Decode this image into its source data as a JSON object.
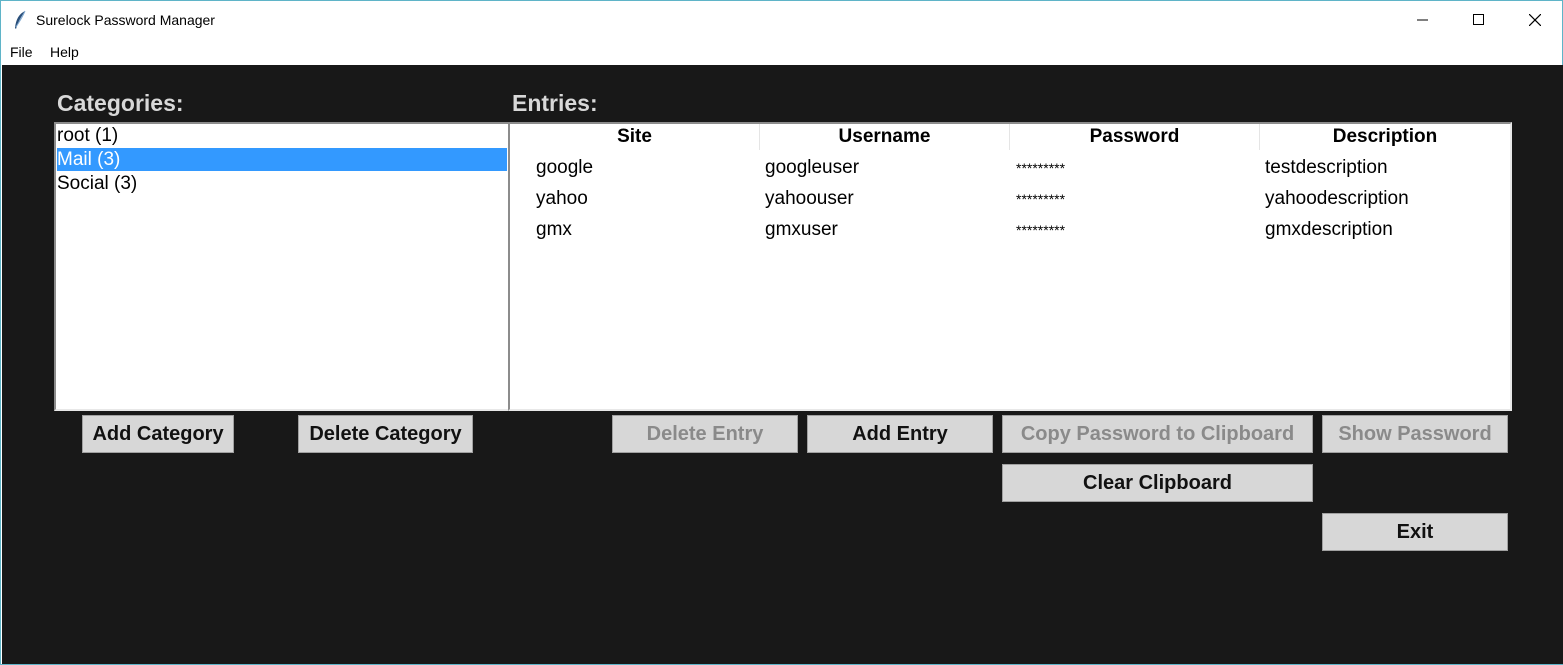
{
  "window": {
    "title": "Surelock Password Manager",
    "app_icon": "feather-icon",
    "controls": [
      "minimize-icon",
      "maximize-icon",
      "close-icon"
    ]
  },
  "menu": {
    "items": [
      {
        "label": "File"
      },
      {
        "label": "Help"
      }
    ]
  },
  "categories": {
    "label": "Categories:",
    "items": [
      {
        "label": "root (1)",
        "selected": false
      },
      {
        "label": "Mail (3)",
        "selected": true
      },
      {
        "label": "Social (3)",
        "selected": false
      }
    ],
    "buttons": {
      "add": "Add Category",
      "delete": "Delete Category"
    }
  },
  "entries": {
    "label": "Entries:",
    "columns": [
      "Site",
      "Username",
      "Password",
      "Description"
    ],
    "rows": [
      {
        "site": "google",
        "username": "googleuser",
        "password": "*********",
        "description": "testdescription"
      },
      {
        "site": "yahoo",
        "username": "yahoouser",
        "password": "*********",
        "description": "yahoodescription"
      },
      {
        "site": "gmx",
        "username": "gmxuser",
        "password": "*********",
        "description": "gmxdescription"
      }
    ],
    "buttons": {
      "delete": "Delete Entry",
      "add": "Add Entry",
      "copy": "Copy Password to Clipboard",
      "show": "Show Password",
      "clear": "Clear Clipboard",
      "exit": "Exit"
    }
  },
  "colors": {
    "background": "#181818",
    "selection": "#3399ff",
    "button": "#d7d7d7",
    "label": "#d8d8d8"
  }
}
